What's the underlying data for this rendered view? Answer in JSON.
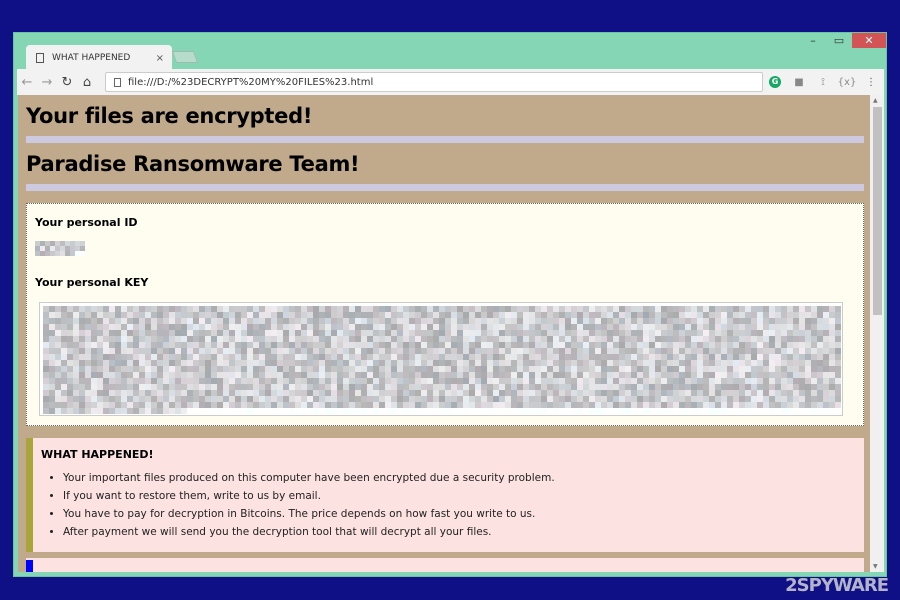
{
  "browser": {
    "tab_title": "WHAT HAPPENED",
    "url": "file:///D:/%23DECRYPT%20MY%20FILES%23.html",
    "icons": [
      "back-icon",
      "forward-icon",
      "reload-icon",
      "home-icon",
      "grammarly-icon",
      "extension-icon",
      "extension-icon",
      "extension-icon",
      "menu-icon"
    ]
  },
  "page": {
    "heading1": "Your files are encrypted!",
    "heading2": "Paradise Ransomware Team!",
    "id_label": "Your personal ID",
    "key_label": "Your personal KEY",
    "what_happened": {
      "title": "WHAT HAPPENED!",
      "items": [
        "Your important files produced on this computer have been encrypted due a security problem.",
        "If you want to restore them, write to us by email.",
        "You have to pay for decryption in Bitcoins. The price depends on how fast you write to us.",
        "After payment we will send you the decryption tool that will decrypt all your files."
      ]
    }
  },
  "colors": {
    "desktop": "#0f0f86",
    "frame": "#84d6b4",
    "page_bg": "#c1aa8b",
    "accent_bar": "#a8a63a",
    "alert_bg": "#fde2e2"
  },
  "watermark": "2SPYWARE"
}
